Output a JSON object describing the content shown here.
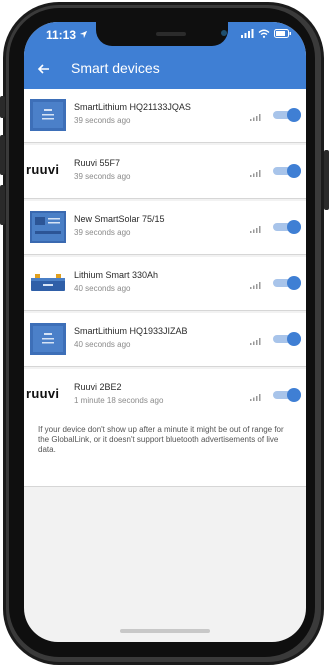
{
  "status_bar": {
    "time": "11:13"
  },
  "header": {
    "title": "Smart devices",
    "accent": "#3f7fd4"
  },
  "devices": [
    {
      "name": "SmartLithium HQ21133JQAS",
      "time": "39 seconds ago",
      "icon": "smart-lithium-thumb",
      "enabled": true
    },
    {
      "name": "Ruuvi 55F7",
      "time": "39 seconds ago",
      "icon": "ruuvi-logo",
      "enabled": true
    },
    {
      "name": "New SmartSolar 75/15",
      "time": "39 seconds ago",
      "icon": "smartsolar-thumb",
      "enabled": true
    },
    {
      "name": "Lithium Smart 330Ah",
      "time": "40 seconds ago",
      "icon": "battery-thumb",
      "enabled": true
    },
    {
      "name": "SmartLithium HQ1933JIZAB",
      "time": "40 seconds ago",
      "icon": "smart-lithium-thumb",
      "enabled": true
    },
    {
      "name": "Ruuvi 2BE2",
      "time": "1 minute 18 seconds ago",
      "icon": "ruuvi-logo",
      "enabled": true
    }
  ],
  "ruuvi_logo_text": "ruuvi",
  "note": "If your device don't show up after a minute it might be out of range for the GlobalLink, or it doesn't support bluetooth advertisements of live data."
}
